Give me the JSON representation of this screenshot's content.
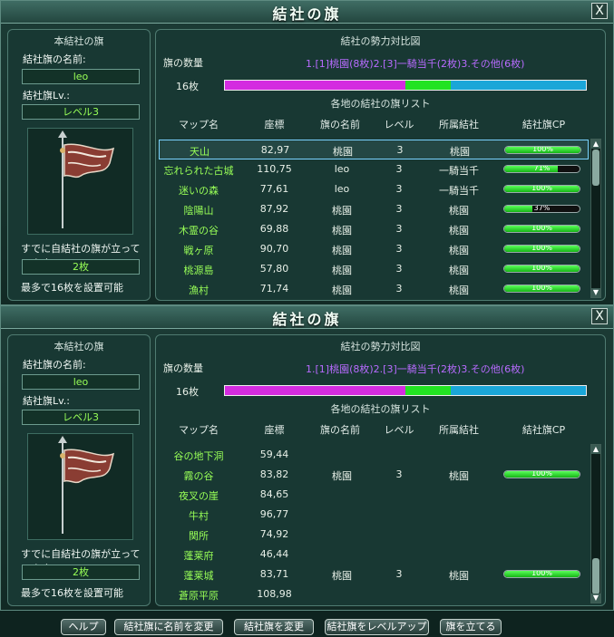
{
  "windows": [
    {
      "title": "結社の旗",
      "close_label": "X",
      "left": {
        "section_title": "本結社の旗",
        "name_label": "結社旗の名前:",
        "name_value": "leo",
        "level_label": "結社旗Lv.:",
        "level_value": "レベル3",
        "standing_label": "すでに自結社の旗が立っています",
        "standing_value": "2枚",
        "max_note": "最多で16枚を設置可能"
      },
      "right": {
        "section_title": "結社の勢力対比図",
        "legend": "1.[1]桃園(8枚)2.[3]一騎当千(2枚)3.その他(6枚)",
        "flag_count_label": "旗の数量",
        "flag_total": "16枚",
        "bar_fractions": [
          0.5,
          0.125,
          0.375
        ],
        "list_title": "各地の結社の旗リスト",
        "columns": [
          "マップ名",
          "座標",
          "旗の名前",
          "レベル",
          "所属結社",
          "結社旗CP"
        ],
        "rows": [
          {
            "map": "天山",
            "coord": "82,97",
            "flag": "桃園",
            "level": "3",
            "guild": "桃園",
            "cp": 100,
            "cp_label": "100%",
            "selected": true
          },
          {
            "map": "忘れられた古城",
            "coord": "110,75",
            "flag": "leo",
            "level": "3",
            "guild": "一騎当千",
            "cp": 71,
            "cp_label": "71%"
          },
          {
            "map": "迷いの森",
            "coord": "77,61",
            "flag": "leo",
            "level": "3",
            "guild": "一騎当千",
            "cp": 100,
            "cp_label": "100%"
          },
          {
            "map": "陰陽山",
            "coord": "87,92",
            "flag": "桃園",
            "level": "3",
            "guild": "桃園",
            "cp": 37,
            "cp_label": "37%"
          },
          {
            "map": "木霊の谷",
            "coord": "69,88",
            "flag": "桃園",
            "level": "3",
            "guild": "桃園",
            "cp": 100,
            "cp_label": "100%"
          },
          {
            "map": "戦ヶ原",
            "coord": "90,70",
            "flag": "桃園",
            "level": "3",
            "guild": "桃園",
            "cp": 100,
            "cp_label": "100%"
          },
          {
            "map": "桃源島",
            "coord": "57,80",
            "flag": "桃園",
            "level": "3",
            "guild": "桃園",
            "cp": 100,
            "cp_label": "100%"
          },
          {
            "map": "漁村",
            "coord": "71,74",
            "flag": "桃園",
            "level": "3",
            "guild": "桃園",
            "cp": 100,
            "cp_label": "100%"
          }
        ],
        "scroll_position": 0.0
      }
    },
    {
      "title": "結社の旗",
      "close_label": "X",
      "left": {
        "section_title": "本結社の旗",
        "name_label": "結社旗の名前:",
        "name_value": "leo",
        "level_label": "結社旗Lv.:",
        "level_value": "レベル3",
        "standing_label": "すでに自結社の旗が立っています",
        "standing_value": "2枚",
        "max_note": "最多で16枚を設置可能"
      },
      "right": {
        "section_title": "結社の勢力対比図",
        "legend": "1.[1]桃園(8枚)2.[3]一騎当千(2枚)3.その他(6枚)",
        "flag_count_label": "旗の数量",
        "flag_total": "16枚",
        "bar_fractions": [
          0.5,
          0.125,
          0.375
        ],
        "list_title": "各地の結社の旗リスト",
        "columns": [
          "マップ名",
          "座標",
          "旗の名前",
          "レベル",
          "所属結社",
          "結社旗CP"
        ],
        "rows": [
          {
            "map": "谷の地下洞",
            "coord": "59,44",
            "flag": "",
            "level": "",
            "guild": "",
            "cp": null,
            "cp_label": ""
          },
          {
            "map": "霧の谷",
            "coord": "83,82",
            "flag": "桃園",
            "level": "3",
            "guild": "桃園",
            "cp": 100,
            "cp_label": "100%"
          },
          {
            "map": "夜叉の崖",
            "coord": "84,65",
            "flag": "",
            "level": "",
            "guild": "",
            "cp": null,
            "cp_label": ""
          },
          {
            "map": "牛村",
            "coord": "96,77",
            "flag": "",
            "level": "",
            "guild": "",
            "cp": null,
            "cp_label": ""
          },
          {
            "map": "関所",
            "coord": "74,92",
            "flag": "",
            "level": "",
            "guild": "",
            "cp": null,
            "cp_label": ""
          },
          {
            "map": "蓬莱府",
            "coord": "46,44",
            "flag": "",
            "level": "",
            "guild": "",
            "cp": null,
            "cp_label": ""
          },
          {
            "map": "蓬莱城",
            "coord": "83,71",
            "flag": "桃園",
            "level": "3",
            "guild": "桃園",
            "cp": 100,
            "cp_label": "100%"
          },
          {
            "map": "蒼原平原",
            "coord": "108,98",
            "flag": "",
            "level": "",
            "guild": "",
            "cp": null,
            "cp_label": ""
          }
        ],
        "scroll_position": 1.0
      }
    }
  ],
  "buttons": [
    "ヘルプ",
    "結社旗に名前を変更",
    "結社旗を変更",
    "結社旗をレベルアップ",
    "旗を立てる"
  ],
  "colors": {
    "guild1": "#d42ce0",
    "guild2": "#22e322",
    "other": "#1aa6d8",
    "map_name": "#98ff57"
  }
}
